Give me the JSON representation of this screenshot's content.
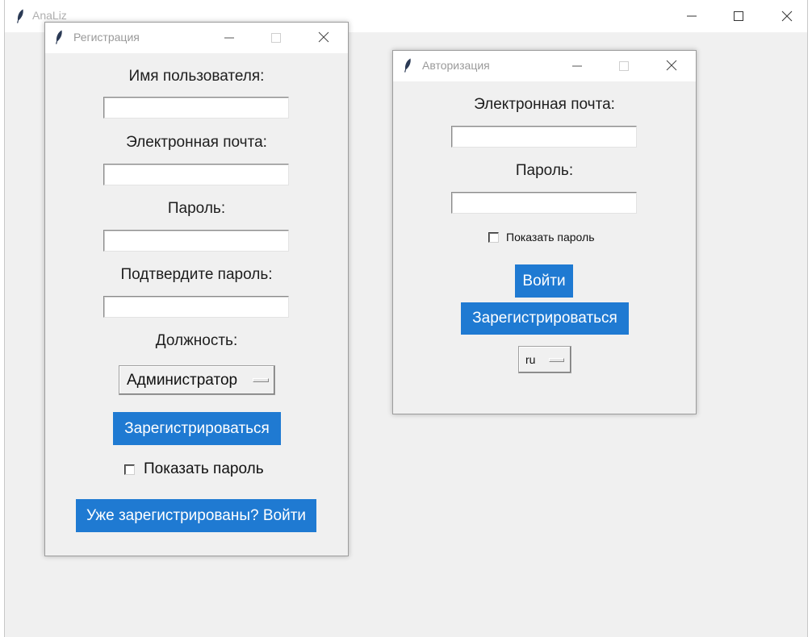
{
  "main_window": {
    "title": "AnaLiz",
    "icon": "feather-icon"
  },
  "register_window": {
    "title": "Регистрация",
    "icon": "feather-icon",
    "username_label": "Имя пользователя:",
    "username_value": "",
    "email_label": "Электронная почта:",
    "email_value": "",
    "password_label": "Пароль:",
    "password_value": "",
    "confirm_label": "Подтвердите пароль:",
    "confirm_value": "",
    "role_label": "Должность:",
    "role_selected": "Администратор",
    "register_button": "Зарегистрироваться",
    "show_password_label": "Показать пароль",
    "show_password_checked": false,
    "login_link_button": "Уже зарегистрированы? Войти"
  },
  "login_window": {
    "title": "Авторизация",
    "icon": "feather-icon",
    "email_label": "Электронная почта:",
    "email_value": "",
    "password_label": "Пароль:",
    "password_value": "",
    "show_password_label": "Показать пароль",
    "show_password_checked": false,
    "login_button": "Войти",
    "register_button": "Зарегистрироваться",
    "language_selected": "ru"
  },
  "colors": {
    "accent": "#1f7ad2",
    "window_bg": "#f0f0f0",
    "title_text": "#9a9a9a"
  }
}
